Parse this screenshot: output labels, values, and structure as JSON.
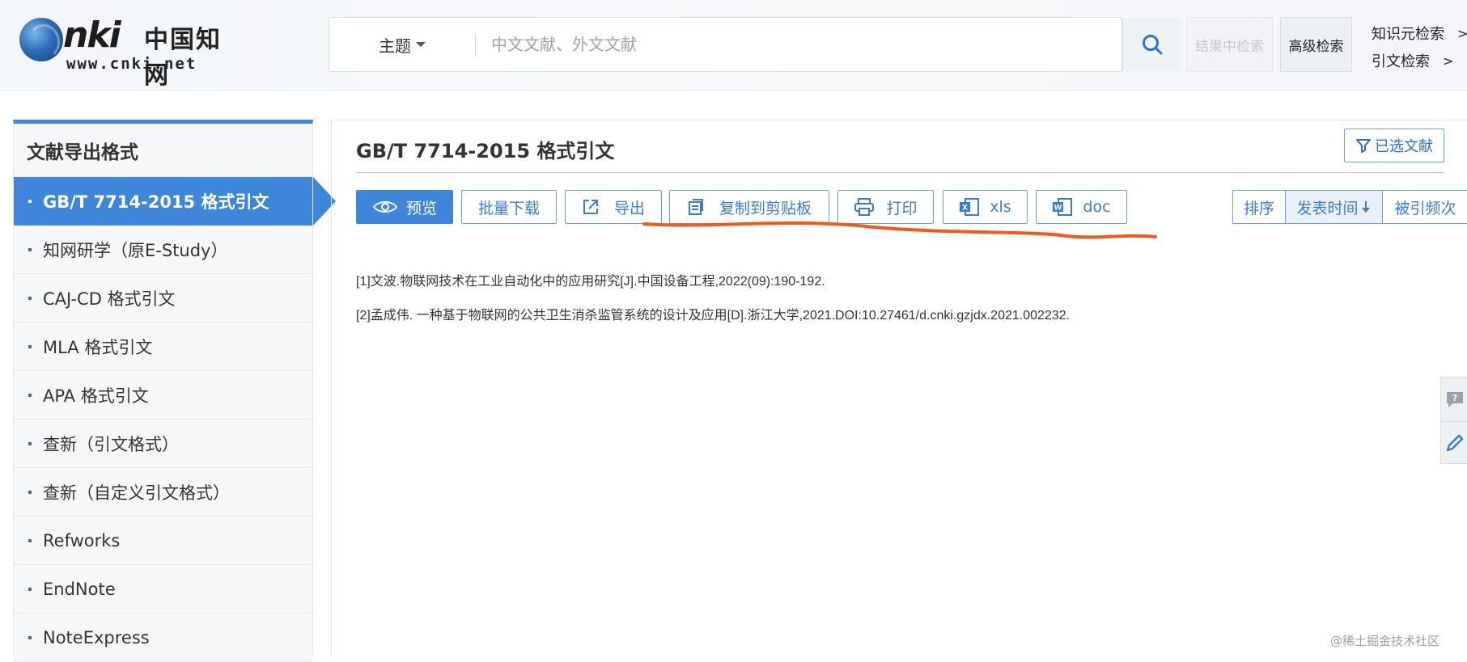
{
  "header": {
    "logo": {
      "text_nki": "nki",
      "text_cn": "中国知网",
      "text_url": "www.cnki.net"
    },
    "search": {
      "field_label": "主题",
      "placeholder": "中文文献、外文文献",
      "value": ""
    },
    "result_search_label": "结果中检索",
    "advanced_search_label": "高级检索",
    "side_links": [
      {
        "label": "知识元检索",
        "arrow": ">"
      },
      {
        "label": "引文检索",
        "arrow": ">"
      }
    ]
  },
  "sidebar": {
    "title": "文献导出格式",
    "items": [
      {
        "label": "GB/T 7714-2015 格式引文",
        "active": true
      },
      {
        "label": "知网研学（原E-Study）",
        "active": false
      },
      {
        "label": "CAJ-CD 格式引文",
        "active": false
      },
      {
        "label": "MLA 格式引文",
        "active": false
      },
      {
        "label": "APA 格式引文",
        "active": false
      },
      {
        "label": "查新（引文格式）",
        "active": false
      },
      {
        "label": "查新（自定义引文格式）",
        "active": false
      },
      {
        "label": "Refworks",
        "active": false
      },
      {
        "label": "EndNote",
        "active": false
      },
      {
        "label": "NoteExpress",
        "active": false
      }
    ]
  },
  "main": {
    "title": "GB/T 7714-2015 格式引文",
    "selected_docs_label": "已选文献",
    "toolbar": {
      "preview": "预览",
      "batch_download": "批量下载",
      "export": "导出",
      "copy_clipboard": "复制到剪贴板",
      "print": "打印",
      "xls": "xls",
      "doc": "doc"
    },
    "sort": {
      "label": "排序",
      "publish_time": "发表时间",
      "cited_count": "被引频次"
    },
    "references": [
      "[1]文波.物联网技术在工业自动化中的应用研究[J].中国设备工程,2022(09):190-192.",
      "[2]孟成伟. 一种基于物联网的公共卫生消杀监管系统的设计及应用[D].浙江大学,2021.DOI:10.27461/d.cnki.gzjdx.2021.002232."
    ]
  },
  "colors": {
    "accent": "#3e86d9",
    "annotation": "#f05a1a"
  },
  "watermark": "@稀土掘金技术社区"
}
